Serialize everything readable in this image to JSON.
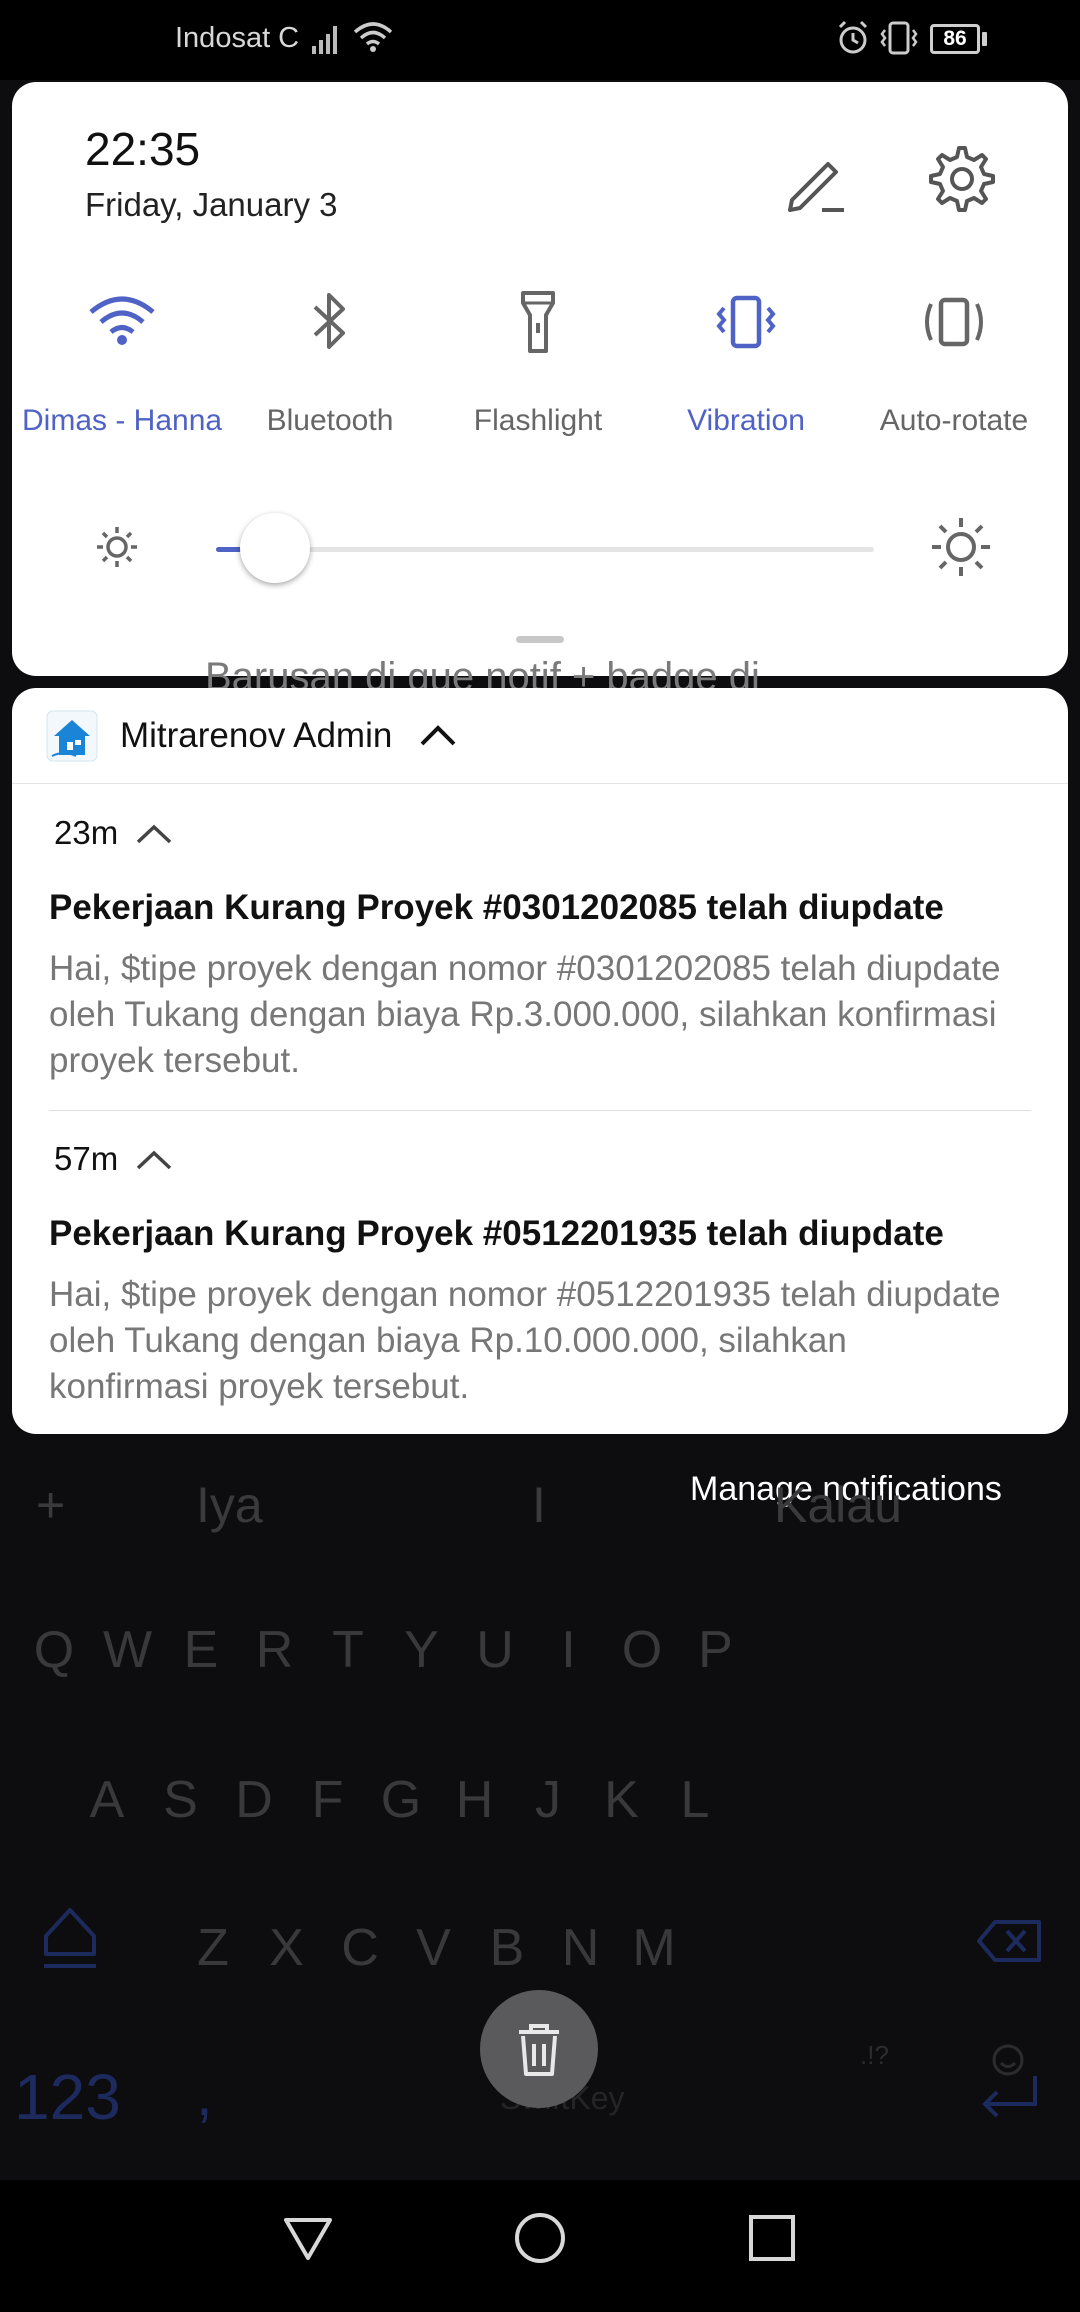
{
  "status_bar": {
    "carrier": "Indosat C",
    "battery": "86",
    "icons": [
      "signal-icon",
      "wifi-icon",
      "alarm-icon",
      "vibrate-icon",
      "battery-icon"
    ]
  },
  "quick_settings": {
    "time": "22:35",
    "date": "Friday, January 3",
    "tiles": [
      {
        "label": "Dimas - Hanna",
        "icon": "wifi-icon",
        "active": true
      },
      {
        "label": "Bluetooth",
        "icon": "bluetooth-icon",
        "active": false
      },
      {
        "label": "Flashlight",
        "icon": "flashlight-icon",
        "active": false
      },
      {
        "label": "Vibration",
        "icon": "vibration-icon",
        "active": true
      },
      {
        "label": "Auto-rotate",
        "icon": "auto-rotate-icon",
        "active": false
      }
    ],
    "brightness_level": 0.09,
    "accent_color": "#4f62c6"
  },
  "background_peek_text": "Barusan di gue notif + badge di",
  "notification_group": {
    "app_name": "Mitrarenov Admin",
    "notifications": [
      {
        "time": "23m",
        "title": "Pekerjaan Kurang Proyek #0301202085 telah diupdate",
        "body": "Hai, $tipe proyek dengan nomor #0301202085 telah diupdate oleh Tukang dengan biaya Rp.3.000.000, silahkan konfirmasi proyek tersebut."
      },
      {
        "time": "57m",
        "title": "Pekerjaan Kurang Proyek #0512201935 telah diupdate",
        "body": "Hai, $tipe proyek dengan nomor #0512201935 telah diupdate oleh Tukang dengan biaya Rp.10.000.000, silahkan konfirmasi proyek tersebut."
      }
    ]
  },
  "manage_notifications": "Manage notifications",
  "keyboard": {
    "suggestions": [
      "+",
      "Iya",
      "I",
      "Kalau"
    ],
    "rows": [
      [
        "Q",
        "W",
        "E",
        "R",
        "T",
        "Y",
        "U",
        "I",
        "O",
        "P"
      ],
      [
        "A",
        "S",
        "D",
        "F",
        "G",
        "H",
        "J",
        "K",
        "L"
      ],
      [
        "Z",
        "X",
        "C",
        "V",
        "B",
        "N",
        "M"
      ]
    ],
    "numbers_key": "123",
    "comma_key": ",",
    "brand": "SwiftKey",
    "punct_key": ".!?"
  }
}
